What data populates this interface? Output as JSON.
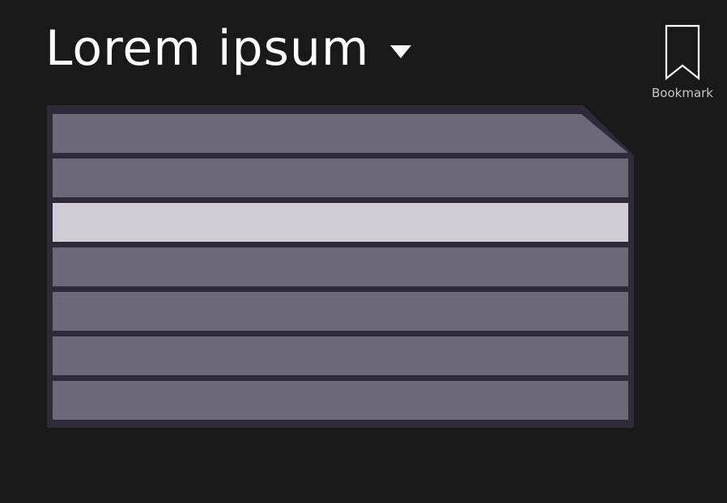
{
  "header": {
    "title": "Lorem ipsum",
    "dropdown_icon": "caret-down-icon"
  },
  "bookmark": {
    "label": "Bookmark",
    "icon": "bookmark-icon"
  },
  "list": {
    "row_count": 7,
    "selected_index": 2
  },
  "colors": {
    "background": "#191919",
    "row": "#6e6679",
    "row_selected": "#d0cdd5",
    "frame": "#2f2a3a"
  }
}
